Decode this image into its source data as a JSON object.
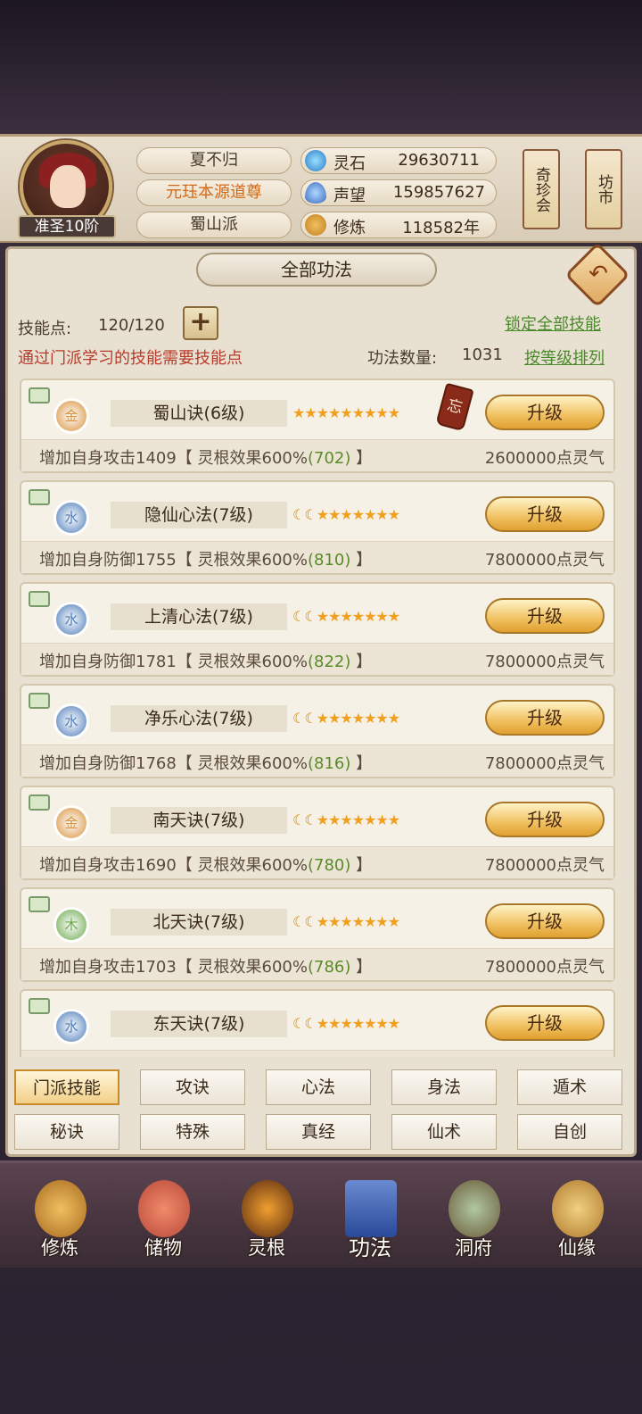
{
  "player": {
    "name": "夏不归",
    "title": "元珏本源道尊",
    "sect": "蜀山派",
    "rank": "准圣10阶"
  },
  "resources": [
    {
      "icon": "spirit-stone-icon",
      "label": "灵石",
      "value": "29630711"
    },
    {
      "icon": "reputation-icon",
      "label": "声望",
      "value": "159857627"
    },
    {
      "icon": "cultivation-icon",
      "label": "修炼",
      "value": "118582年"
    }
  ],
  "scrolls": {
    "qizhenhui": "奇珍会",
    "fangshi": "坊市"
  },
  "panel": {
    "title": "全部功法",
    "skill_points_label": "技能点:",
    "skill_points_value": "120/120",
    "lock_all": "锁定全部技能",
    "notice": "通过门派学习的技能需要技能点",
    "count_label": "功法数量:",
    "count_value": "1031",
    "sort": "按等级排列"
  },
  "skills": [
    {
      "element": "金",
      "name": "蜀山诀(6级)",
      "moons": 0,
      "stars": 9,
      "forget": "忘",
      "upgrade": "升级",
      "desc_pre": "增加自身攻击1409【 灵根效果600%",
      "desc_bonus": "(702)",
      "desc_post": " 】",
      "cost": "2600000点灵气",
      "element_color": "#d8903a"
    },
    {
      "element": "水",
      "name": "隐仙心法(7级)",
      "moons": 2,
      "stars": 7,
      "upgrade": "升级",
      "desc_pre": "增加自身防御1755【 灵根效果600%",
      "desc_bonus": "(810)",
      "desc_post": " 】",
      "cost": "7800000点灵气",
      "element_color": "#4a7ab8"
    },
    {
      "element": "水",
      "name": "上清心法(7级)",
      "moons": 2,
      "stars": 7,
      "upgrade": "升级",
      "desc_pre": "增加自身防御1781【 灵根效果600%",
      "desc_bonus": "(822)",
      "desc_post": " 】",
      "cost": "7800000点灵气",
      "element_color": "#4a7ab8"
    },
    {
      "element": "水",
      "name": "净乐心法(7级)",
      "moons": 2,
      "stars": 7,
      "upgrade": "升级",
      "desc_pre": "增加自身防御1768【 灵根效果600%",
      "desc_bonus": "(816)",
      "desc_post": " 】",
      "cost": "7800000点灵气",
      "element_color": "#4a7ab8"
    },
    {
      "element": "金",
      "name": "南天诀(7级)",
      "moons": 2,
      "stars": 7,
      "upgrade": "升级",
      "desc_pre": "增加自身攻击1690【 灵根效果600%",
      "desc_bonus": "(780)",
      "desc_post": " 】",
      "cost": "7800000点灵气",
      "element_color": "#d8903a"
    },
    {
      "element": "木",
      "name": "北天诀(7级)",
      "moons": 2,
      "stars": 7,
      "upgrade": "升级",
      "desc_pre": "增加自身攻击1703【 灵根效果600%",
      "desc_bonus": "(786)",
      "desc_post": " 】",
      "cost": "7800000点灵气",
      "element_color": "#6aa84a"
    },
    {
      "element": "水",
      "name": "东天诀(7级)",
      "moons": 2,
      "stars": 7,
      "upgrade": "升级",
      "desc_pre": "",
      "desc_bonus": "",
      "desc_post": "",
      "cost": "",
      "element_color": "#4a7ab8"
    }
  ],
  "tabs": [
    {
      "label": "门派技能",
      "active": true
    },
    {
      "label": "攻诀"
    },
    {
      "label": "心法"
    },
    {
      "label": "身法"
    },
    {
      "label": "遁术"
    },
    {
      "label": "秘诀"
    },
    {
      "label": "特殊"
    },
    {
      "label": "真经"
    },
    {
      "label": "仙术"
    },
    {
      "label": "自创"
    }
  ],
  "nav": [
    {
      "label": "修炼",
      "icon": "meditation-icon"
    },
    {
      "label": "储物",
      "icon": "bag-icon"
    },
    {
      "label": "灵根",
      "icon": "spirit-root-icon"
    },
    {
      "label": "功法",
      "icon": "book-icon",
      "selected": true
    },
    {
      "label": "洞府",
      "icon": "cave-house-icon"
    },
    {
      "label": "仙缘",
      "icon": "gourd-icon"
    }
  ]
}
